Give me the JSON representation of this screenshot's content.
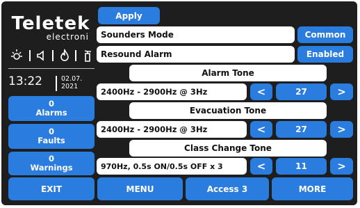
{
  "brand": {
    "name": "Teletek",
    "sub": "electroni"
  },
  "status_icons": [
    "sun-icon",
    "speaker-icon",
    "fire-icon",
    "fire-extinguisher-icon"
  ],
  "clock": {
    "time": "13:22",
    "date_line1": "02.07.",
    "date_line2": "2021"
  },
  "apply_label": "Apply",
  "left_stats": [
    {
      "count": "0",
      "label": "Alarms"
    },
    {
      "count": "0",
      "label": "Faults"
    },
    {
      "count": "0",
      "label": "Warnings"
    }
  ],
  "settings": {
    "sounders_mode": {
      "label": "Sounders Mode",
      "value": "Common"
    },
    "resound_alarm": {
      "label": "Resound Alarm",
      "value": "Enabled"
    }
  },
  "tones": [
    {
      "title": "Alarm Tone",
      "value": "2400Hz - 2900Hz @ 3Hz",
      "number": "27"
    },
    {
      "title": "Evacuation Tone",
      "value": "2400Hz - 2900Hz @ 3Hz",
      "number": "27"
    },
    {
      "title": "Class Change Tone",
      "value": "970Hz, 0.5s ON/0.5s OFF x 3",
      "number": "11"
    }
  ],
  "nav": {
    "prev_glyph": "<",
    "next_glyph": ">"
  },
  "bottom": {
    "exit": "EXIT",
    "menu": "MENU",
    "access": "Access 3",
    "more": "MORE"
  }
}
